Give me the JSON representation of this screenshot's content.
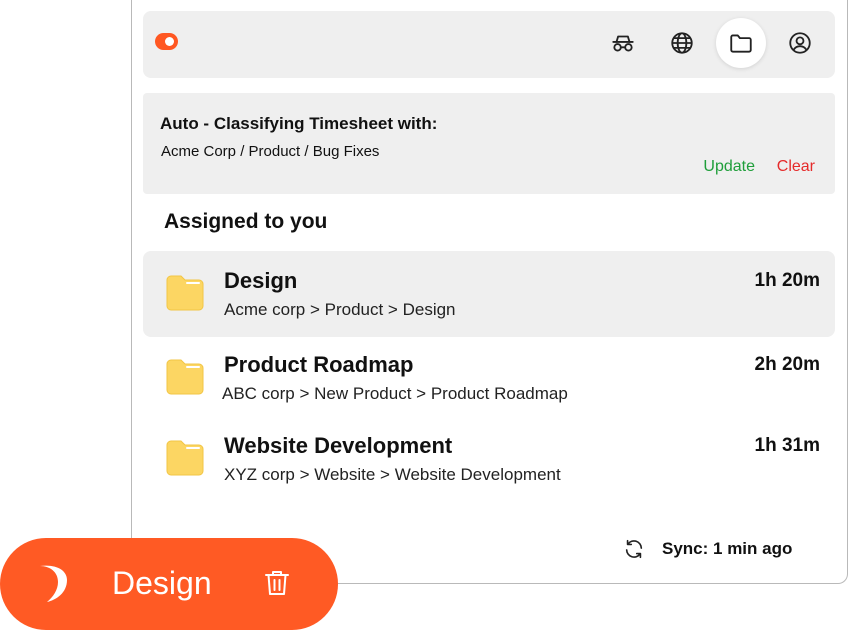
{
  "topbar": {
    "icons": [
      "incognito-icon",
      "globe-icon",
      "folder-icon",
      "user-icon"
    ],
    "active_icon": "folder-icon"
  },
  "banner": {
    "title": "Auto - Classifying Timesheet with:",
    "path": "Acme Corp / Product / Bug Fixes",
    "update_label": "Update",
    "clear_label": "Clear"
  },
  "section": {
    "title": "Assigned to you"
  },
  "projects": [
    {
      "name": "Design",
      "path": "Acme corp > Product > Design",
      "time": "1h 20m",
      "selected": true
    },
    {
      "name": "Product Roadmap",
      "path": "ABC corp > New Product > Product Roadmap",
      "time": "2h 20m",
      "selected": false
    },
    {
      "name": "Website Development",
      "path": "XYZ corp > Website > Website Development",
      "time": "1h 31m",
      "selected": false
    }
  ],
  "sync": {
    "label": "Sync: 1 min ago"
  },
  "pill": {
    "label": "Design"
  },
  "colors": {
    "brand": "#ff5a24",
    "update": "#1f9e3a",
    "clear": "#e52b2b",
    "folder": "#fcd663"
  }
}
